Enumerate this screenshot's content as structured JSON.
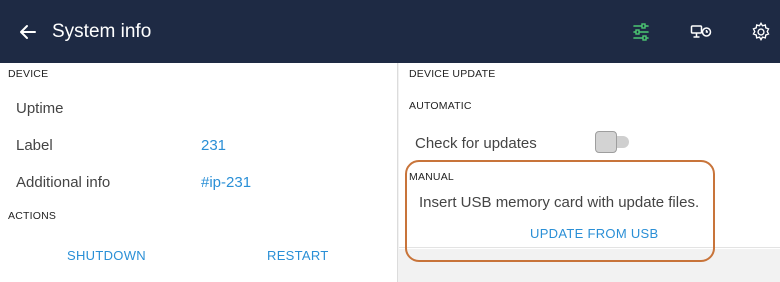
{
  "header": {
    "back_icon": "arrow-left-icon",
    "title": "System info",
    "icons": [
      "sliders-icon",
      "monitor-icon",
      "gear-icon"
    ],
    "accent": "#1e2a44",
    "active_icon_color": "#4cc873"
  },
  "device": {
    "heading": "DEVICE",
    "rows": [
      {
        "label": "Uptime",
        "value": ""
      },
      {
        "label": "Label",
        "value": "231"
      },
      {
        "label": "Additional info",
        "value": "#ip-231"
      }
    ]
  },
  "actions": {
    "heading": "ACTIONS",
    "shutdown": "SHUTDOWN",
    "restart": "RESTART"
  },
  "device_update": {
    "heading": "DEVICE UPDATE",
    "automatic": {
      "heading": "AUTOMATIC",
      "check_label": "Check for updates",
      "check_enabled": false
    },
    "manual": {
      "heading": "MANUAL",
      "instruction": "Insert USB memory card with update files.",
      "button": "UPDATE FROM USB"
    }
  },
  "colors": {
    "link": "#2a8fd6",
    "highlight": "#c8743a"
  }
}
